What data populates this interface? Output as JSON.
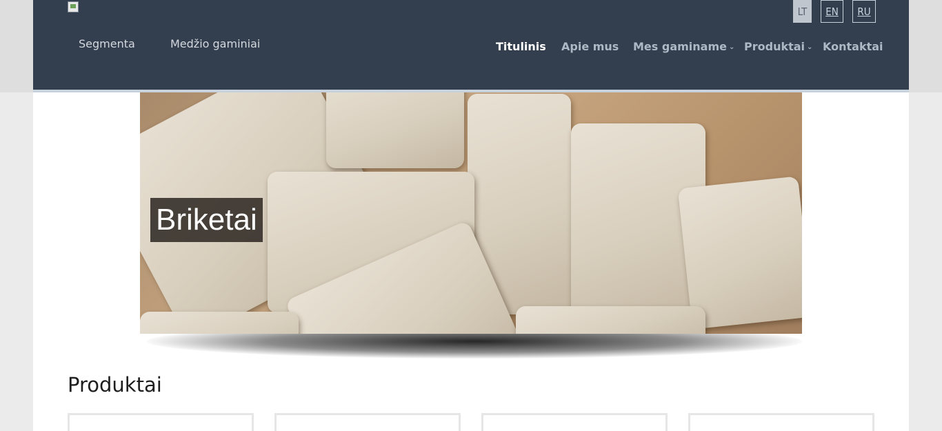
{
  "header": {
    "logo_icon": "broken-image-icon",
    "brand": [
      "Segmenta",
      "Medžio gaminiai"
    ],
    "languages": [
      {
        "code": "LT",
        "active": true
      },
      {
        "code": "EN",
        "active": false
      },
      {
        "code": "RU",
        "active": false
      }
    ],
    "nav": [
      {
        "label": "Titulinis",
        "active": true,
        "dropdown": false
      },
      {
        "label": "Apie mus",
        "active": false,
        "dropdown": false
      },
      {
        "label": "Mes gaminame",
        "active": false,
        "dropdown": true
      },
      {
        "label": "Produktai",
        "active": false,
        "dropdown": true
      },
      {
        "label": "Kontaktai",
        "active": false,
        "dropdown": false
      }
    ],
    "dropdown_icon": "chevron-down-icon"
  },
  "hero": {
    "caption": "Briketai"
  },
  "products": {
    "title": "Produktai"
  },
  "colors": {
    "header_bg": "#333f4f",
    "nav_text": "#aeb9c6",
    "nav_active": "#ffffff"
  }
}
